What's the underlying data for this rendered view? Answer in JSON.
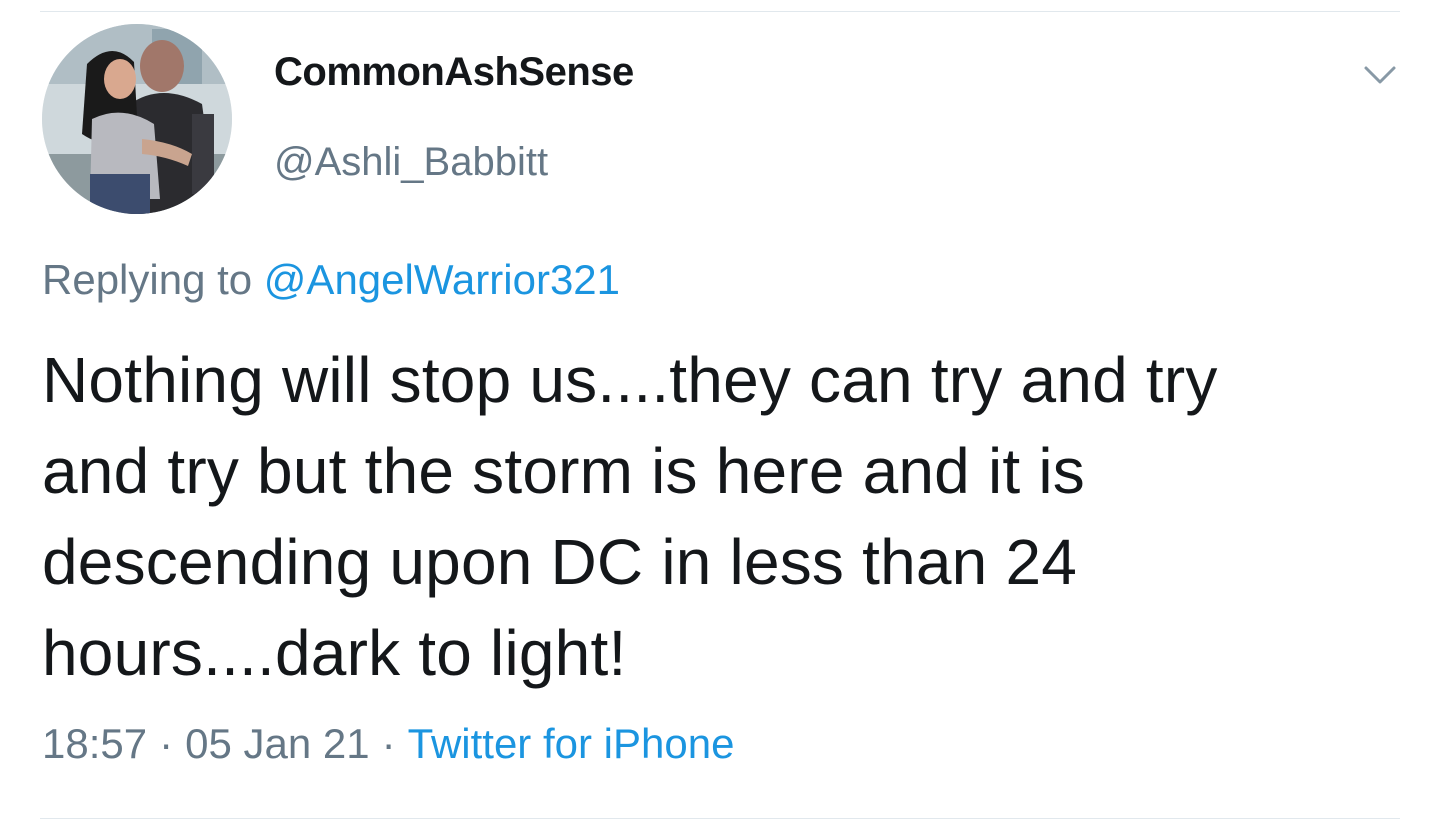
{
  "tweet": {
    "display_name": "CommonAshSense",
    "handle": "@Ashli_Babbitt",
    "replying_prefix": "Replying to",
    "replying_mention": "@AngelWarrior321",
    "text": "Nothing will stop us....they can try and try and try but the storm is here and it is descending upon DC in less than 24 hours....dark to light!",
    "time": "18:57",
    "date": "05 Jan 21",
    "separator": "·",
    "source": "Twitter for iPhone"
  },
  "icons": {
    "menu": "chevron-down-icon",
    "avatar": "avatar"
  },
  "colors": {
    "primary_text": "#14171a",
    "secondary_text": "#657786",
    "link": "#1b95e0",
    "divider": "#e1e8ed"
  }
}
